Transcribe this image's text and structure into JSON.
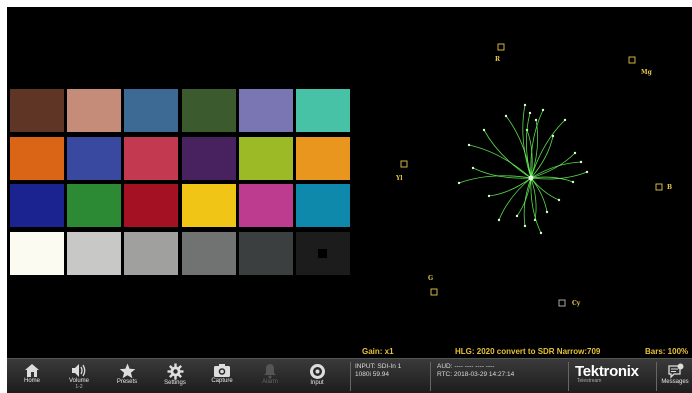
{
  "checker": {
    "rows": [
      [
        "#5f3526",
        "#c48c79",
        "#3d6995",
        "#3b5a2e",
        "#7a76b3",
        "#48c2a7"
      ],
      [
        "#db6516",
        "#3949a0",
        "#c33a50",
        "#48215f",
        "#9cba25",
        "#e8961d"
      ],
      [
        "#1b2390",
        "#2c8a35",
        "#a41123",
        "#f1c515",
        "#bd3c8f",
        "#0f89ab"
      ],
      [
        "#fcfbf2",
        "#c8c8c6",
        "#a0a09f",
        "#717372",
        "#3c3f3f",
        "#1c1c1c"
      ]
    ]
  },
  "scope": {
    "targets": [
      {
        "label": "R"
      },
      {
        "label": "Mg"
      },
      {
        "label": "B"
      },
      {
        "label": "Yl"
      },
      {
        "label": "G"
      },
      {
        "label": "Cy"
      }
    ],
    "trace_color": "#6bff5a"
  },
  "status": {
    "gain": "Gain: x1",
    "mode": "HLG: 2020 convert to SDR Narrow:709",
    "bars": "Bars: 100%",
    "color": "#e6c23a"
  },
  "toolbar": {
    "buttons": [
      {
        "id": "home",
        "label": "Home",
        "icon": "home-icon"
      },
      {
        "id": "volume",
        "label": "Volume",
        "sub": "1-2",
        "icon": "speaker-icon"
      },
      {
        "id": "presets",
        "label": "Presets",
        "icon": "star-icon"
      },
      {
        "id": "settings",
        "label": "Settings",
        "icon": "gear-icon"
      },
      {
        "id": "capture",
        "label": "Capture",
        "icon": "camera-icon"
      },
      {
        "id": "alarm",
        "label": "Alarm",
        "icon": "bell-icon",
        "disabled": true
      },
      {
        "id": "input",
        "label": "Input",
        "icon": "input-icon"
      }
    ],
    "input_info": {
      "line1": "INPUT: SDI-In 1",
      "line2": "1080i 59.94"
    },
    "audio_info": {
      "line1": "AUD: ---- ---- ---- ----",
      "line2": "RTC: 2018-03-29 14:27:14"
    },
    "brand": {
      "name": "Tektronix",
      "sub": "Telestream"
    },
    "messages": {
      "label": "Messages",
      "icon": "messages-icon"
    }
  }
}
